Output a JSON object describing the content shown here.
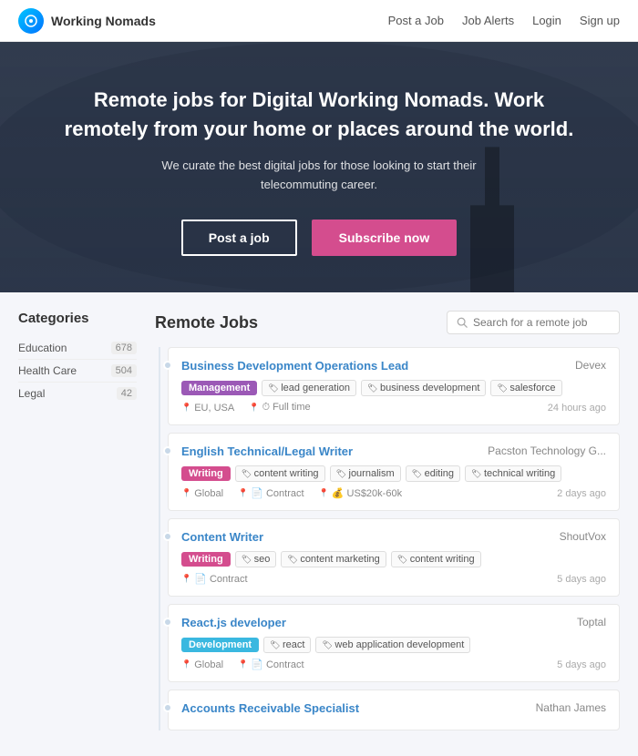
{
  "navbar": {
    "brand_name": "Working Nomads",
    "links": [
      {
        "label": "Post a Job",
        "href": "#"
      },
      {
        "label": "Job Alerts",
        "href": "#"
      },
      {
        "label": "Login",
        "href": "#"
      },
      {
        "label": "Sign up",
        "href": "#"
      }
    ]
  },
  "hero": {
    "headline": "Remote jobs for Digital Working Nomads. Work remotely from your home or places around the world.",
    "subtext": "We curate the best digital jobs for those looking to start their telecommuting career.",
    "btn_post": "Post a job",
    "btn_subscribe": "Subscribe now"
  },
  "sidebar": {
    "title": "Categories",
    "items": [
      {
        "label": "Education",
        "count": "678"
      },
      {
        "label": "Health Care",
        "count": "504"
      },
      {
        "label": "Legal",
        "count": "42"
      }
    ]
  },
  "job_list": {
    "title": "Remote Jobs",
    "search_placeholder": "Search for a remote job",
    "jobs": [
      {
        "title": "Business Development Operations Lead",
        "company": "Devex",
        "category": "Management",
        "category_type": "management",
        "skills": [
          "lead generation",
          "business development",
          "salesforce"
        ],
        "meta": [
          {
            "icon": "location",
            "text": "EU, USA"
          },
          {
            "icon": "clock",
            "text": "Full time"
          }
        ],
        "time": "24 hours ago"
      },
      {
        "title": "English Technical/Legal Writer",
        "company": "Pacston Technology G...",
        "category": "Writing",
        "category_type": "writing",
        "skills": [
          "content writing",
          "journalism",
          "editing",
          "technical writing"
        ],
        "meta": [
          {
            "icon": "location",
            "text": "Global"
          },
          {
            "icon": "contract",
            "text": "Contract"
          },
          {
            "icon": "salary",
            "text": "US$20k-60k"
          }
        ],
        "time": "2 days ago"
      },
      {
        "title": "Content Writer",
        "company": "ShoutVox",
        "category": "Writing",
        "category_type": "writing",
        "skills": [
          "seo",
          "content marketing",
          "content writing"
        ],
        "meta": [
          {
            "icon": "contract",
            "text": "Contract"
          }
        ],
        "time": "5 days ago"
      },
      {
        "title": "React.js developer",
        "company": "Toptal",
        "category": "Development",
        "category_type": "development",
        "skills": [
          "react",
          "web application development"
        ],
        "meta": [
          {
            "icon": "location",
            "text": "Global"
          },
          {
            "icon": "contract",
            "text": "Contract"
          }
        ],
        "time": "5 days ago"
      },
      {
        "title": "Accounts Receivable Specialist",
        "company": "Nathan James",
        "category": "",
        "category_type": "",
        "skills": [],
        "meta": [],
        "time": ""
      }
    ]
  }
}
